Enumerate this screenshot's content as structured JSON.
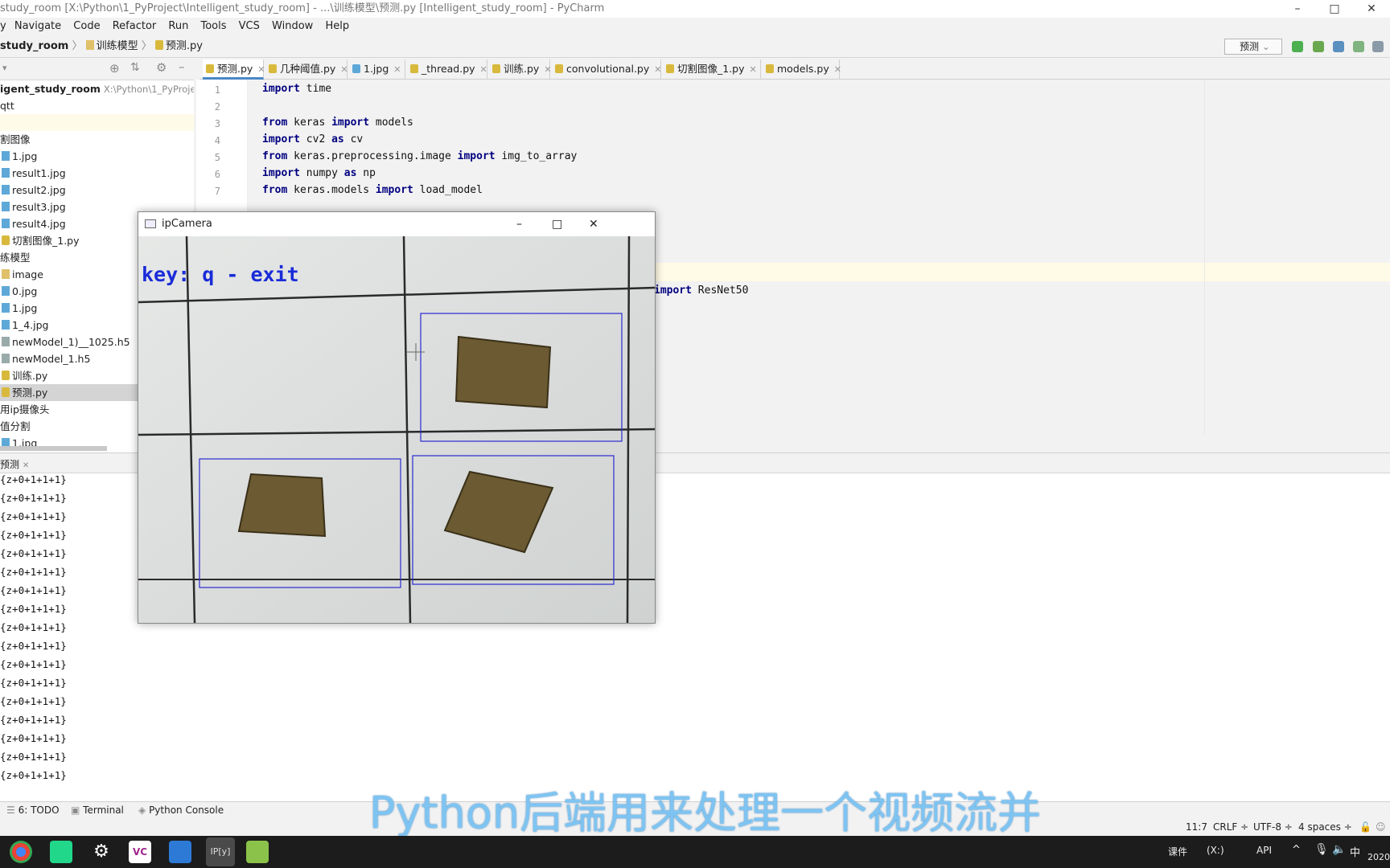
{
  "window": {
    "title": "study_room [X:\\Python\\1_PyProject\\Intelligent_study_room] - ...\\训练模型\\预测.py [Intelligent_study_room] - PyCharm"
  },
  "menu": [
    "Navigate",
    "Code",
    "Refactor",
    "Run",
    "Tools",
    "VCS",
    "Window",
    "Help"
  ],
  "breadcrumb": {
    "project": "study_room",
    "folder": "训练模型",
    "file": "预测.py"
  },
  "run_config": "预测",
  "project": {
    "root_name": "igent_study_room",
    "root_path": "X:\\Python\\1_PyProject\\",
    "items": [
      "qtt",
      "",
      "割图像",
      "1.jpg",
      "result1.jpg",
      "result2.jpg",
      "result3.jpg",
      "result4.jpg",
      "切割图像_1.py",
      "练模型",
      "image",
      "0.jpg",
      "1.jpg",
      "1_4.jpg",
      "newModel_1)__1025.h5",
      "newModel_1.h5",
      "训练.py",
      "预测.py",
      "用ip摄像头",
      "值分割",
      "1.jpg"
    ]
  },
  "tabs": [
    "预测.py",
    "几种阈值.py",
    "1.jpg",
    "_thread.py",
    "训练.py",
    "convolutional.py",
    "切割图像_1.py",
    "models.py"
  ],
  "code_lines": [
    {
      "n": "1",
      "t": "import time"
    },
    {
      "n": "2",
      "t": ""
    },
    {
      "n": "3",
      "t": "from keras import models"
    },
    {
      "n": "4",
      "t": "import cv2 as cv"
    },
    {
      "n": "5",
      "t": "from keras.preprocessing.image import img_to_array"
    },
    {
      "n": "6",
      "t": "import numpy as np"
    },
    {
      "n": "7",
      "t": "from keras.models import load_model"
    }
  ],
  "code_partial": "import ResNet50",
  "run_tab": "预测",
  "output_lines": [
    "{z+0+1+1+1}",
    "{z+0+1+1+1}",
    "{z+0+1+1+1}",
    "{z+0+1+1+1}",
    "{z+0+1+1+1}",
    "{z+0+1+1+1}",
    "{z+0+1+1+1}",
    "{z+0+1+1+1}",
    "{z+0+1+1+1}",
    "{z+0+1+1+1}",
    "{z+0+1+1+1}",
    "{z+0+1+1+1}",
    "{z+0+1+1+1}",
    "{z+0+1+1+1}",
    "{z+0+1+1+1}",
    "{z+0+1+1+1}",
    "{z+0+1+1+1}"
  ],
  "bottom_tools": {
    "todo": "6: TODO",
    "terminal": "Terminal",
    "console": "Python Console"
  },
  "status": {
    "pos": "11:7",
    "eol": "CRLF ÷",
    "enc": "UTF-8 ÷",
    "indent": "4 spaces ÷"
  },
  "camera": {
    "title": "ipCamera",
    "overlay": "key: q - exit"
  },
  "subtitle": "Python后端用来处理一个视频流并",
  "taskbar_tray": {
    "label1": "课件",
    "label2": "(X:)",
    "label3": "API",
    "ime": "中",
    "clock": "2020"
  }
}
